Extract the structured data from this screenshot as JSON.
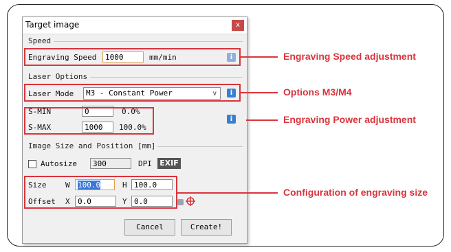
{
  "dialog": {
    "title": "Target image",
    "close_symbol": "x"
  },
  "speed": {
    "section_label": "Speed",
    "label": "Engraving Speed",
    "value": "1000",
    "unit": "mm/min"
  },
  "laser": {
    "section_label": "Laser Options",
    "mode_label": "Laser Mode",
    "mode_value": "M3 - Constant Power",
    "smin_label": "S-MIN",
    "smin_value": "0",
    "smin_percent": "0.0%",
    "smax_label": "S-MAX",
    "smax_value": "1000",
    "smax_percent": "100.0%"
  },
  "image": {
    "section_label": "Image Size and Position [mm]",
    "autosize_label": "Autosize",
    "autosize_checked": false,
    "dpi_value": "300",
    "dpi_label": "DPI",
    "exif_label": "EXIF",
    "size_label": "Size",
    "w_label": "W",
    "w_value": "100.0",
    "h_label": "H",
    "h_value": "100.0",
    "offset_label": "Offset",
    "x_label": "X",
    "x_value": "0.0",
    "y_label": "Y",
    "y_value": "0.0"
  },
  "buttons": {
    "cancel": "Cancel",
    "create": "Create!"
  },
  "info_symbol": "i",
  "annotations": {
    "speed": "Engraving Speed adjustment",
    "options": "Options M3/M4",
    "power": "Engraving Power adjustment",
    "size": "Configuration of engraving size"
  },
  "colors": {
    "highlight": "#d9343c",
    "info_button": "#3a7fd0",
    "selection": "#3a78d6"
  },
  "icons": {
    "close": "close-icon",
    "info": "info-icon",
    "combo_arrow": "chevron-down-icon",
    "lock": "lock-icon",
    "center": "crosshair-icon"
  }
}
